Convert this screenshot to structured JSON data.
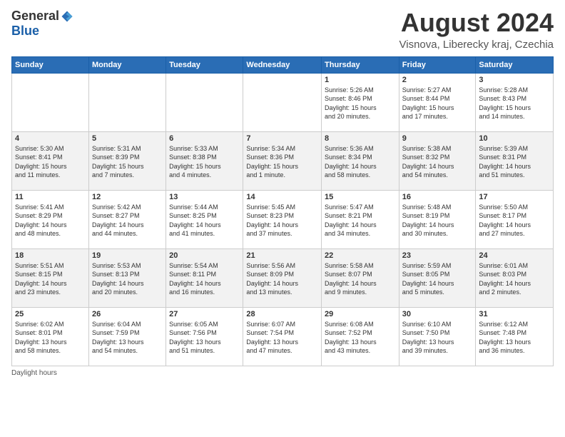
{
  "logo": {
    "general": "General",
    "blue": "Blue"
  },
  "title": "August 2024",
  "subtitle": "Visnova, Liberecky kraj, Czechia",
  "days_of_week": [
    "Sunday",
    "Monday",
    "Tuesday",
    "Wednesday",
    "Thursday",
    "Friday",
    "Saturday"
  ],
  "weeks": [
    [
      {
        "day": "",
        "info": ""
      },
      {
        "day": "",
        "info": ""
      },
      {
        "day": "",
        "info": ""
      },
      {
        "day": "",
        "info": ""
      },
      {
        "day": "1",
        "info": "Sunrise: 5:26 AM\nSunset: 8:46 PM\nDaylight: 15 hours\nand 20 minutes."
      },
      {
        "day": "2",
        "info": "Sunrise: 5:27 AM\nSunset: 8:44 PM\nDaylight: 15 hours\nand 17 minutes."
      },
      {
        "day": "3",
        "info": "Sunrise: 5:28 AM\nSunset: 8:43 PM\nDaylight: 15 hours\nand 14 minutes."
      }
    ],
    [
      {
        "day": "4",
        "info": "Sunrise: 5:30 AM\nSunset: 8:41 PM\nDaylight: 15 hours\nand 11 minutes."
      },
      {
        "day": "5",
        "info": "Sunrise: 5:31 AM\nSunset: 8:39 PM\nDaylight: 15 hours\nand 7 minutes."
      },
      {
        "day": "6",
        "info": "Sunrise: 5:33 AM\nSunset: 8:38 PM\nDaylight: 15 hours\nand 4 minutes."
      },
      {
        "day": "7",
        "info": "Sunrise: 5:34 AM\nSunset: 8:36 PM\nDaylight: 15 hours\nand 1 minute."
      },
      {
        "day": "8",
        "info": "Sunrise: 5:36 AM\nSunset: 8:34 PM\nDaylight: 14 hours\nand 58 minutes."
      },
      {
        "day": "9",
        "info": "Sunrise: 5:38 AM\nSunset: 8:32 PM\nDaylight: 14 hours\nand 54 minutes."
      },
      {
        "day": "10",
        "info": "Sunrise: 5:39 AM\nSunset: 8:31 PM\nDaylight: 14 hours\nand 51 minutes."
      }
    ],
    [
      {
        "day": "11",
        "info": "Sunrise: 5:41 AM\nSunset: 8:29 PM\nDaylight: 14 hours\nand 48 minutes."
      },
      {
        "day": "12",
        "info": "Sunrise: 5:42 AM\nSunset: 8:27 PM\nDaylight: 14 hours\nand 44 minutes."
      },
      {
        "day": "13",
        "info": "Sunrise: 5:44 AM\nSunset: 8:25 PM\nDaylight: 14 hours\nand 41 minutes."
      },
      {
        "day": "14",
        "info": "Sunrise: 5:45 AM\nSunset: 8:23 PM\nDaylight: 14 hours\nand 37 minutes."
      },
      {
        "day": "15",
        "info": "Sunrise: 5:47 AM\nSunset: 8:21 PM\nDaylight: 14 hours\nand 34 minutes."
      },
      {
        "day": "16",
        "info": "Sunrise: 5:48 AM\nSunset: 8:19 PM\nDaylight: 14 hours\nand 30 minutes."
      },
      {
        "day": "17",
        "info": "Sunrise: 5:50 AM\nSunset: 8:17 PM\nDaylight: 14 hours\nand 27 minutes."
      }
    ],
    [
      {
        "day": "18",
        "info": "Sunrise: 5:51 AM\nSunset: 8:15 PM\nDaylight: 14 hours\nand 23 minutes."
      },
      {
        "day": "19",
        "info": "Sunrise: 5:53 AM\nSunset: 8:13 PM\nDaylight: 14 hours\nand 20 minutes."
      },
      {
        "day": "20",
        "info": "Sunrise: 5:54 AM\nSunset: 8:11 PM\nDaylight: 14 hours\nand 16 minutes."
      },
      {
        "day": "21",
        "info": "Sunrise: 5:56 AM\nSunset: 8:09 PM\nDaylight: 14 hours\nand 13 minutes."
      },
      {
        "day": "22",
        "info": "Sunrise: 5:58 AM\nSunset: 8:07 PM\nDaylight: 14 hours\nand 9 minutes."
      },
      {
        "day": "23",
        "info": "Sunrise: 5:59 AM\nSunset: 8:05 PM\nDaylight: 14 hours\nand 5 minutes."
      },
      {
        "day": "24",
        "info": "Sunrise: 6:01 AM\nSunset: 8:03 PM\nDaylight: 14 hours\nand 2 minutes."
      }
    ],
    [
      {
        "day": "25",
        "info": "Sunrise: 6:02 AM\nSunset: 8:01 PM\nDaylight: 13 hours\nand 58 minutes."
      },
      {
        "day": "26",
        "info": "Sunrise: 6:04 AM\nSunset: 7:59 PM\nDaylight: 13 hours\nand 54 minutes."
      },
      {
        "day": "27",
        "info": "Sunrise: 6:05 AM\nSunset: 7:56 PM\nDaylight: 13 hours\nand 51 minutes."
      },
      {
        "day": "28",
        "info": "Sunrise: 6:07 AM\nSunset: 7:54 PM\nDaylight: 13 hours\nand 47 minutes."
      },
      {
        "day": "29",
        "info": "Sunrise: 6:08 AM\nSunset: 7:52 PM\nDaylight: 13 hours\nand 43 minutes."
      },
      {
        "day": "30",
        "info": "Sunrise: 6:10 AM\nSunset: 7:50 PM\nDaylight: 13 hours\nand 39 minutes."
      },
      {
        "day": "31",
        "info": "Sunrise: 6:12 AM\nSunset: 7:48 PM\nDaylight: 13 hours\nand 36 minutes."
      }
    ]
  ],
  "footer": "Daylight hours"
}
